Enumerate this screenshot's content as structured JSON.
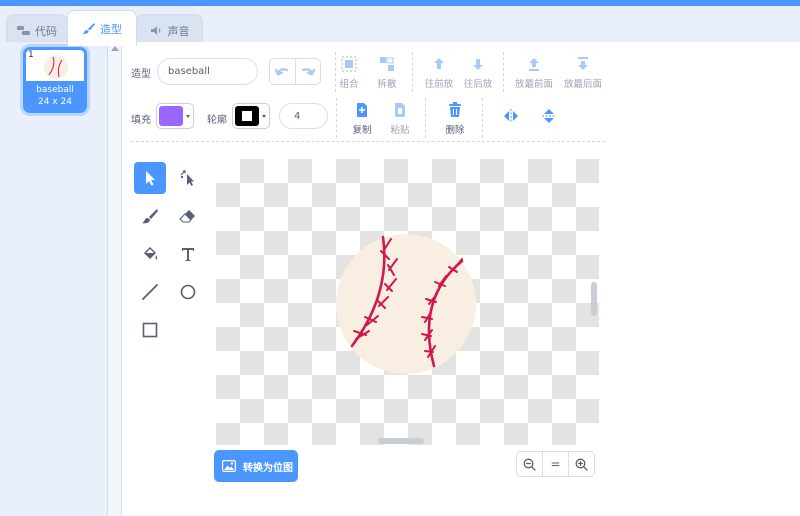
{
  "tabs": [
    {
      "label": "代码",
      "icon": "code-icon"
    },
    {
      "label": "造型",
      "icon": "brush-icon"
    },
    {
      "label": "声音",
      "icon": "speaker-icon"
    }
  ],
  "costume_list": {
    "items": [
      {
        "number": "1",
        "name": "baseball",
        "size": "24 x 24"
      }
    ]
  },
  "toolbar": {
    "costume_label": "造型",
    "costume_name": "baseball",
    "fill_label": "填充",
    "fill_color": "#9966ff",
    "outline_label": "轮廓",
    "outline_color": "#000000",
    "outline_width": "4",
    "group": "组合",
    "ungroup": "拆散",
    "forward": "往前放",
    "backward": "往后放",
    "front": "放最前面",
    "back": "放最后面",
    "copy": "复制",
    "paste": "粘贴",
    "delete": "删除"
  },
  "footer": {
    "convert_label": "转换为位图",
    "zoom_reset": "="
  },
  "colors": {
    "accent": "#4c97ff",
    "ball": "#f8eee2",
    "stitch": "#d0184a"
  }
}
